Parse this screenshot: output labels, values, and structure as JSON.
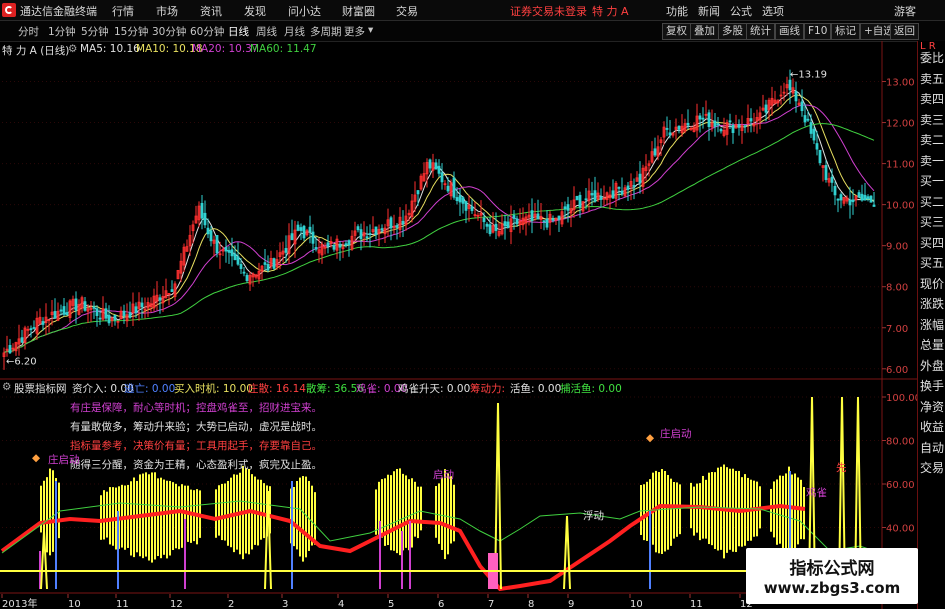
{
  "menubar": {
    "app_title": "通达信金融终端",
    "menus": [
      "行情",
      "市场",
      "资讯",
      "发现",
      "问小达",
      "财富圈",
      "交易"
    ],
    "notice": "证券交易未登录",
    "stock": "特 力 A",
    "right_items": [
      "功能",
      "新闻",
      "公式",
      "选项"
    ],
    "user": "游客"
  },
  "toolbar": {
    "periods": [
      "分时",
      "1分钟",
      "5分钟",
      "15分钟",
      "30分钟",
      "60分钟",
      "日线",
      "周线",
      "月线",
      "多周期",
      "更多"
    ],
    "active_period": "日线",
    "buttons": [
      "复权",
      "叠加",
      "多股",
      "统计",
      "画线",
      "F10",
      "标记",
      "+自选",
      "返回"
    ]
  },
  "side_panel": {
    "items": [
      "委比",
      "卖五",
      "卖四",
      "卖三",
      "卖二",
      "卖一",
      "买一",
      "买二",
      "买三",
      "买四",
      "买五",
      "现价",
      "涨跌",
      "涨幅",
      "总量",
      "外盘",
      "换手",
      "净资",
      "收益",
      "自动",
      "交易"
    ]
  },
  "ma_legend": {
    "stock_label": "特 力 A (日线)",
    "items": [
      {
        "text": "MA5: 10.16",
        "color": "#e0e0e0"
      },
      {
        "text": "MA10: 10.18",
        "color": "#e8e060"
      },
      {
        "text": "MA20: 10.37",
        "color": "#d040d0"
      },
      {
        "text": "MA60: 11.47",
        "color": "#40d040"
      }
    ]
  },
  "price_axis": {
    "ticks": [
      "13.00",
      "12.00",
      "11.00",
      "10.00",
      "9.00",
      "8.00",
      "7.00",
      "6.00"
    ],
    "high_label": "13.19",
    "low_label": "6.20"
  },
  "indicator_legend": {
    "name": "股票指标网",
    "items": [
      {
        "text": "资介入: 0.00",
        "color": "#e0e0e0"
      },
      {
        "text": "逃亡: 0.00",
        "color": "#5080ff"
      },
      {
        "text": "买入时机: 10.00",
        "color": "#e8e060"
      },
      {
        "text": "庄散: 16.14",
        "color": "#ff4040"
      },
      {
        "text": "散筹: 36.56",
        "color": "#40e040"
      },
      {
        "text": "鸡雀: 0.00",
        "color": "#d040d0"
      },
      {
        "text": "鸡雀升天: 0.00",
        "color": "#e0e0e0"
      },
      {
        "text": "筹动力: ",
        "color": "#ff4040"
      },
      {
        "text": "活鱼: 0.00",
        "color": "#e0e0e0"
      },
      {
        "text": "捕活鱼: 0.00",
        "color": "#40e040"
      }
    ]
  },
  "indicator_notes": [
    {
      "text": "有庄是保障，耐心等时机；控盘鸡雀至，招财进宝来。",
      "color": "#d040d0"
    },
    {
      "text": "有量敢做多，筹动升来验；大势已启动，虚况是战时。",
      "color": "#e0e0e0"
    },
    {
      "text": "指标量参考，决策价有量；工具用起手，存要靠自己。",
      "color": "#ff4040"
    },
    {
      "text": "随得三分醒，资金为王精，心态盈利式，疯完及止盈。",
      "color": "#e0e0e0"
    }
  ],
  "indicator_marks": {
    "zhuang_start_left": "庄启动",
    "zhuang_start_right": "庄启动",
    "qidong": "启动",
    "fuqi": "浮动",
    "jiantou": "鸡雀",
    "xian": "先"
  },
  "indicator_axis": {
    "ticks": [
      "100.00",
      "80.00",
      "60.00",
      "40.00",
      "20.00"
    ],
    "times": [
      "14:50",
      "14:50",
      "14:50",
      "14:50",
      "14:50",
      "14:50",
      "14:50",
      "14:50"
    ]
  },
  "date_axis": {
    "labels": [
      "2013年",
      "10",
      "11",
      "12",
      "2",
      "3",
      "4",
      "5",
      "6",
      "7",
      "8",
      "9",
      "10",
      "11",
      "12"
    ]
  },
  "watermark": {
    "title": "指标公式网",
    "url": "www.zbgs3.com"
  },
  "colors": {
    "up": "#ff3030",
    "down": "#30d0d0",
    "ma5": "#e0e0e0",
    "ma10": "#e8e060",
    "ma20": "#d040d0",
    "ma60": "#40d040",
    "bar_yellow": "#ffff40",
    "bar_red": "#ff2020",
    "accent": "#ff4040"
  }
}
